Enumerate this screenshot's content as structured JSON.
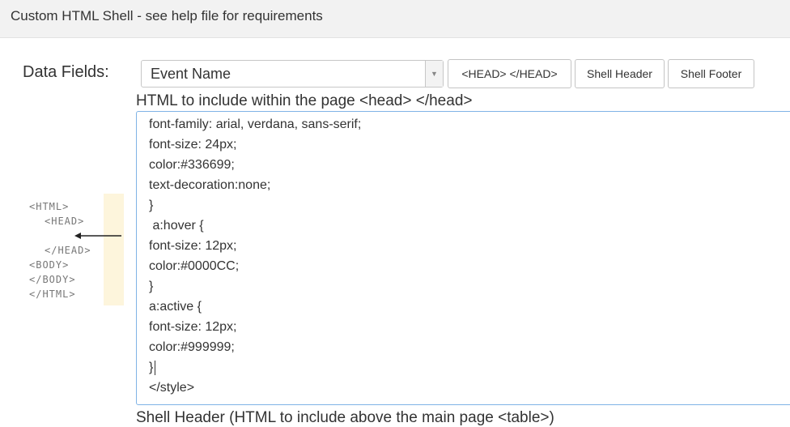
{
  "header": {
    "title": "Custom HTML Shell - see help file for requirements"
  },
  "data_fields": {
    "label": "Data Fields:",
    "selected": "Event Name"
  },
  "toolbar": {
    "head_button": "<HEAD> </HEAD>",
    "shell_header_button": "Shell Header",
    "shell_footer_button": "Shell Footer"
  },
  "head_section": {
    "label": "HTML to include within the page <head> </head>",
    "lines": [
      "font-family: arial, verdana, sans-serif;",
      "font-size: 24px;",
      "color:#336699;",
      "text-decoration:none;",
      "}",
      " a:hover {",
      "font-size: 12px;",
      "color:#0000CC;",
      "}",
      "a:active {",
      "font-size: 12px;",
      "color:#999999;",
      "}",
      "</style>"
    ]
  },
  "shell_header_section": {
    "label": "Shell Header (HTML to include above the main page <table>)"
  },
  "diagram": {
    "lines": [
      "<HTML>",
      "<HEAD>",
      "</HEAD>",
      "<BODY>",
      "</BODY>",
      "</HTML>"
    ]
  }
}
